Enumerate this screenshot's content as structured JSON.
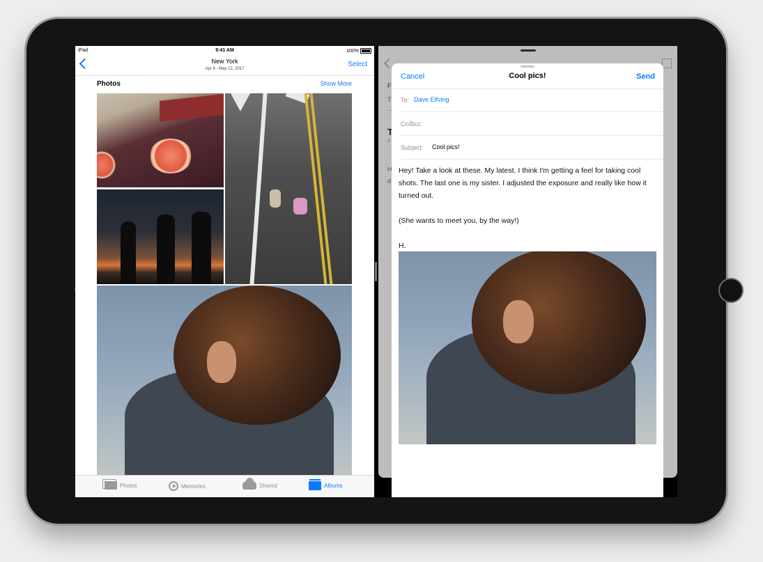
{
  "status_bar": {
    "carrier": "iPad",
    "time": "9:41 AM",
    "battery": "100%"
  },
  "photos_app": {
    "nav": {
      "title": "New York",
      "subtitle": "Apr 8 - May 12, 2017",
      "select_label": "Select"
    },
    "section": {
      "title": "Photos",
      "show_more": "Show More"
    },
    "tabs": [
      {
        "label": "Photos",
        "icon": "photos-icon"
      },
      {
        "label": "Memories",
        "icon": "memories-icon"
      },
      {
        "label": "Shared",
        "icon": "shared-icon"
      },
      {
        "label": "Albums",
        "icon": "albums-icon",
        "active": true
      }
    ]
  },
  "mail_compose": {
    "cancel_label": "Cancel",
    "title": "Cool pics!",
    "send_label": "Send",
    "to_label": "To:",
    "to_value": "Dave Elfving",
    "ccbcc_label": "Cc/Bcc:",
    "subject_label": "Subject:",
    "subject_value": "Cool pics!",
    "body": [
      "Hey! Take a look at these. My latest. I think I'm getting a feel for taking cool shots. The last one is my sister. I adjusted the exposure and really like how it turned out.",
      "(She wants to meet you, by the way!)",
      "H."
    ]
  },
  "mail_background": {
    "snippets": [
      "F",
      "T",
      "T",
      "J",
      "H",
      "d"
    ]
  },
  "colors": {
    "accent": "#0a7aff",
    "device": "#141414",
    "background": "#eeeeee"
  }
}
